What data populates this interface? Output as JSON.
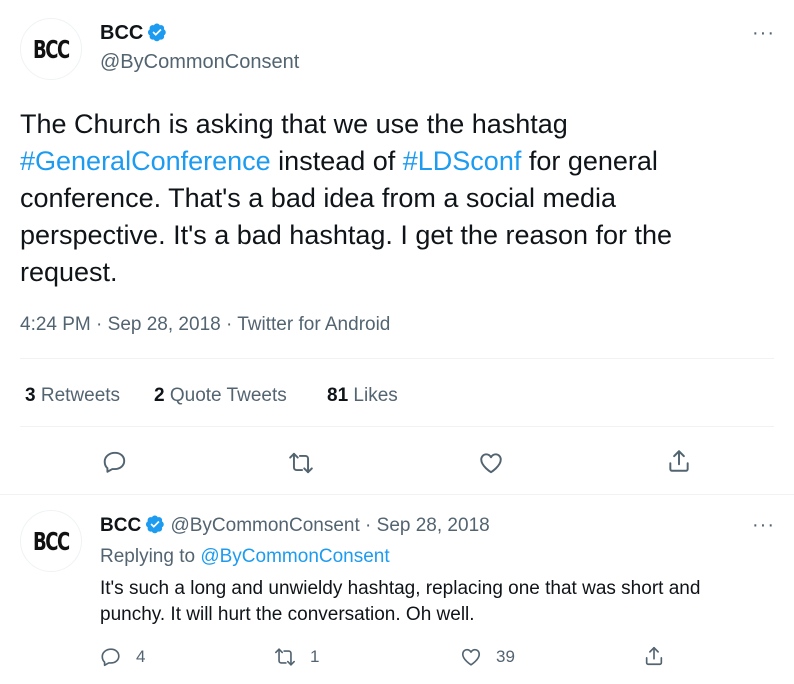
{
  "main_tweet": {
    "avatar_text": "BCC",
    "display_name": "BCC",
    "handle": "@ByCommonConsent",
    "more_label": "···",
    "text_parts": {
      "t1": "The Church is asking that we use the hashtag ",
      "hashtag1": "#GeneralConference",
      "t2": " instead of ",
      "hashtag2": "#LDSconf",
      "t3": " for general conference. That's a bad idea from a social media perspective. It's a bad hashtag. I get the reason for the request."
    },
    "time": "4:24 PM",
    "sep1": "·",
    "date": "Sep 28, 2018",
    "sep2": "·",
    "source": "Twitter for Android",
    "stats": {
      "retweets_count": "3",
      "retweets_label": "Retweets",
      "quotes_count": "2",
      "quotes_label": "Quote Tweets",
      "likes_count": "81",
      "likes_label": "Likes"
    }
  },
  "reply_tweet": {
    "avatar_text": "BCC",
    "display_name": "BCC",
    "handle": "@ByCommonConsent",
    "sep": "·",
    "date": "Sep 28, 2018",
    "more_label": "···",
    "replying_prefix": "Replying to ",
    "replying_handle": "@ByCommonConsent",
    "text": "It's such a long and unwieldy hashtag, replacing one that was short and punchy. It will hurt the conversation. Oh well.",
    "reply_count": "4",
    "retweet_count": "1",
    "like_count": "39"
  },
  "colors": {
    "accent": "#1d9bf0",
    "secondary_text": "#536471",
    "primary_text": "#0f1419",
    "divider": "#eff3f4"
  },
  "icons": [
    "verified-badge-icon",
    "more-icon",
    "reply-icon",
    "retweet-icon",
    "like-icon",
    "share-icon"
  ]
}
